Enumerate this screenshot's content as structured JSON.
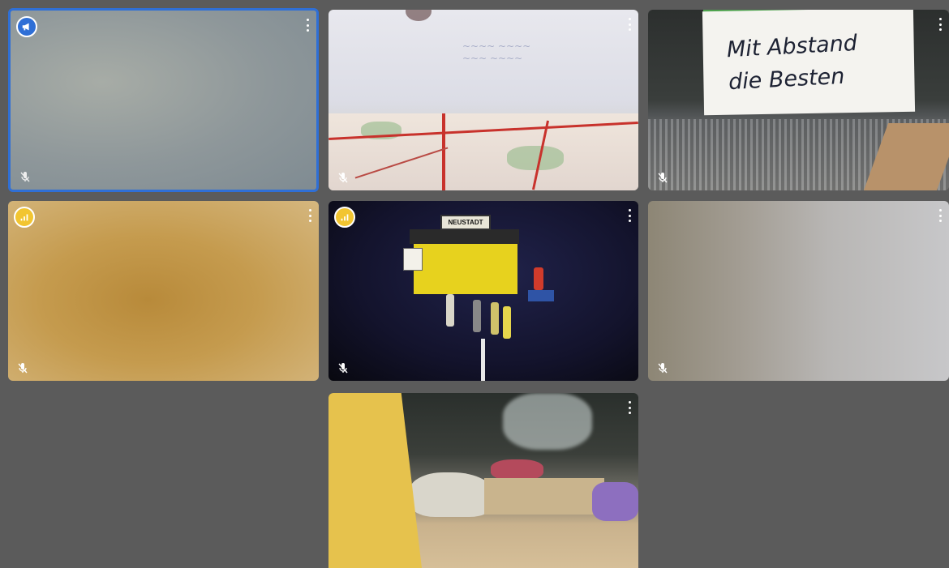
{
  "tiles": [
    {
      "name": "tile-1",
      "speaking": true,
      "badge": "megaphone-icon",
      "muted": true
    },
    {
      "name": "tile-2",
      "badge": null,
      "muted": true
    },
    {
      "name": "tile-3",
      "badge": null,
      "muted": true,
      "note_text_line1": "Mit Abstand",
      "note_text_line2": "die Besten"
    },
    {
      "name": "tile-4",
      "badge": "signal-bars-icon",
      "muted": true
    },
    {
      "name": "tile-5",
      "badge": "signal-bars-icon",
      "muted": true,
      "sign_text": "NEUSTADT"
    },
    {
      "name": "tile-6",
      "badge": null,
      "muted": true
    },
    {
      "name": "tile-7",
      "badge": null,
      "muted": false
    }
  ],
  "colors": {
    "background": "#5b5b5b",
    "active_border": "#2f6fd6",
    "badge_yellow": "#f2c531"
  }
}
